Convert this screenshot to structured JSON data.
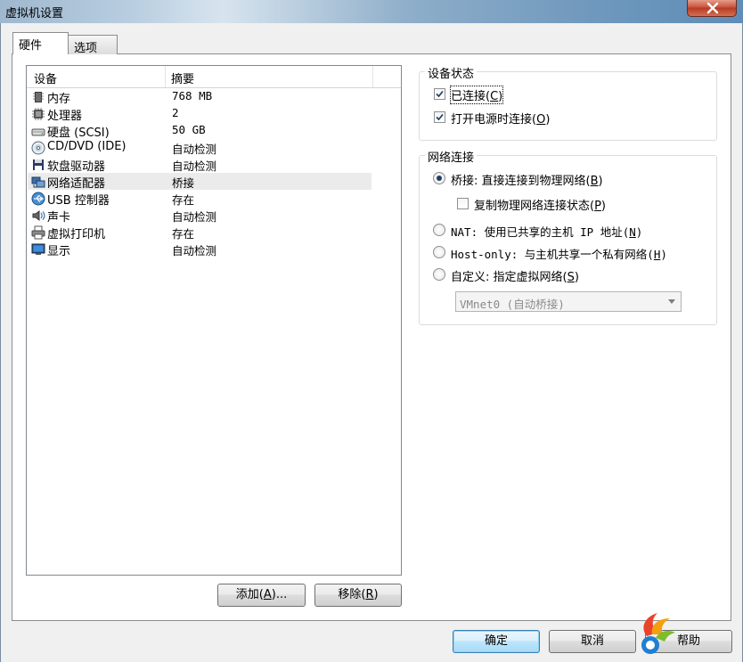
{
  "window": {
    "title": "虚拟机设置"
  },
  "tabs": [
    {
      "label": "硬件",
      "active": true
    },
    {
      "label": "选项",
      "active": false
    }
  ],
  "device_list": {
    "columns": [
      "设备",
      "摘要"
    ],
    "rows": [
      {
        "device": "内存",
        "summary": "768 MB",
        "icon": "memory-icon"
      },
      {
        "device": "处理器",
        "summary": "2",
        "icon": "processor-icon"
      },
      {
        "device": "硬盘 (SCSI)",
        "summary": "50 GB",
        "icon": "hard-disk-icon"
      },
      {
        "device": "CD/DVD (IDE)",
        "summary": "自动检测",
        "icon": "cd-dvd-icon"
      },
      {
        "device": "软盘驱动器",
        "summary": "自动检测",
        "icon": "floppy-icon"
      },
      {
        "device": "网络适配器",
        "summary": "桥接",
        "icon": "network-adapter-icon",
        "selected": true
      },
      {
        "device": "USB 控制器",
        "summary": "存在",
        "icon": "usb-icon"
      },
      {
        "device": "声卡",
        "summary": "自动检测",
        "icon": "sound-card-icon"
      },
      {
        "device": "虚拟打印机",
        "summary": "存在",
        "icon": "printer-icon"
      },
      {
        "device": "显示",
        "summary": "自动检测",
        "icon": "display-icon"
      }
    ]
  },
  "list_buttons": {
    "add": {
      "text": "添加(",
      "key": "A",
      "suffix": ")..."
    },
    "remove": {
      "text": "移除(",
      "key": "R",
      "suffix": ")"
    }
  },
  "device_status": {
    "title": "设备状态",
    "connected": {
      "text": "已连接(",
      "key": "C",
      "suffix": ")",
      "checked": true
    },
    "connect_at_power_on": {
      "text": "打开电源时连接(",
      "key": "O",
      "suffix": ")",
      "checked": true
    }
  },
  "network_connection": {
    "title": "网络连接",
    "bridged": {
      "text": "桥接: 直接连接到物理网络(",
      "key": "B",
      "suffix": ")",
      "selected": true
    },
    "replicate": {
      "text": "复制物理网络连接状态(",
      "key": "P",
      "suffix": ")",
      "checked": false
    },
    "nat": {
      "text": "NAT: 使用已共享的主机 IP 地址(",
      "key": "N",
      "suffix": ")",
      "selected": false
    },
    "host_only": {
      "text": "Host-only: 与主机共享一个私有网络(",
      "key": "H",
      "suffix": ")",
      "selected": false
    },
    "custom": {
      "text": "自定义: 指定虚拟网络(",
      "key": "S",
      "suffix": ")",
      "selected": false
    },
    "custom_select_value": "VMnet0 (自动桥接)"
  },
  "dialog_buttons": {
    "ok": "确定",
    "cancel": "取消",
    "help": "帮助"
  },
  "colors": {
    "selected_row": "#ebebeb",
    "default_button_border": "#3c7fb1",
    "close_button": "#c9503a"
  }
}
